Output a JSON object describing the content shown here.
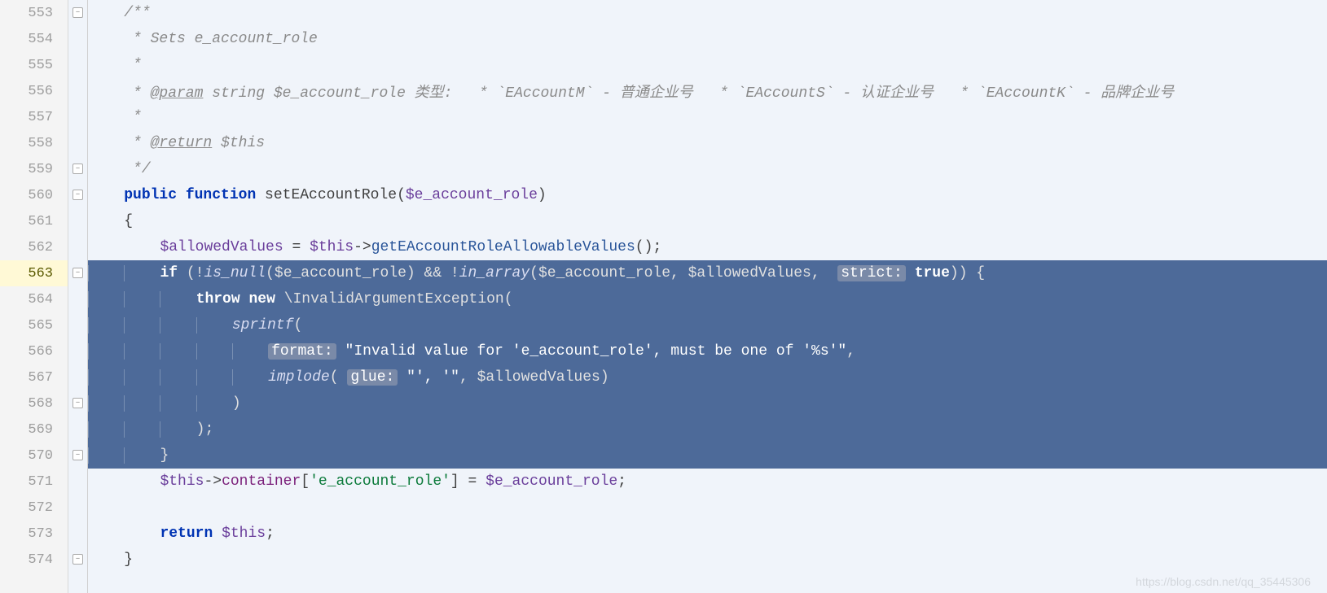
{
  "line_start": 553,
  "current_line": 563,
  "fold_markers": [
    {
      "at": 553,
      "glyph": "–"
    },
    {
      "at": 559,
      "glyph": "–"
    },
    {
      "at": 560,
      "glyph": "–"
    },
    {
      "at": 563,
      "glyph": "–"
    },
    {
      "at": 568,
      "glyph": "–"
    },
    {
      "at": 570,
      "glyph": "–"
    },
    {
      "at": 574,
      "glyph": "–"
    }
  ],
  "hints": {
    "strict": "strict:",
    "format": "format:",
    "glue": "glue:"
  },
  "code": [
    {
      "n": 553,
      "sel": false,
      "indent": 4,
      "tokens": [
        [
          "comment",
          "/**"
        ]
      ]
    },
    {
      "n": 554,
      "sel": false,
      "indent": 4,
      "tokens": [
        [
          "comment",
          " * Sets e_account_role"
        ]
      ]
    },
    {
      "n": 555,
      "sel": false,
      "indent": 4,
      "tokens": [
        [
          "comment",
          " *"
        ]
      ]
    },
    {
      "n": 556,
      "sel": false,
      "indent": 4,
      "tokens": [
        [
          "comment",
          " * "
        ],
        [
          "doctag",
          "@param"
        ],
        [
          "comment",
          " string $e_account_role 类型:   * `EAccountM` - 普通企业号   * `EAccountS` - 认证企业号   * `EAccountK` - 品牌企业号"
        ]
      ]
    },
    {
      "n": 557,
      "sel": false,
      "indent": 4,
      "tokens": [
        [
          "comment",
          " *"
        ]
      ]
    },
    {
      "n": 558,
      "sel": false,
      "indent": 4,
      "tokens": [
        [
          "comment",
          " * "
        ],
        [
          "doctag",
          "@return"
        ],
        [
          "comment",
          " $this"
        ]
      ]
    },
    {
      "n": 559,
      "sel": false,
      "indent": 4,
      "tokens": [
        [
          "comment",
          " */"
        ]
      ]
    },
    {
      "n": 560,
      "sel": false,
      "indent": 4,
      "tokens": [
        [
          "keyword",
          "public function "
        ],
        [
          "plain",
          "setEAccountRole("
        ],
        [
          "var",
          "$e_account_role"
        ],
        [
          "plain",
          ")"
        ]
      ]
    },
    {
      "n": 561,
      "sel": false,
      "indent": 4,
      "tokens": [
        [
          "plain",
          "{"
        ]
      ]
    },
    {
      "n": 562,
      "sel": false,
      "indent": 8,
      "tokens": [
        [
          "var",
          "$allowedValues"
        ],
        [
          "plain",
          " = "
        ],
        [
          "var",
          "$this"
        ],
        [
          "plain",
          "->"
        ],
        [
          "func",
          "getEAccountRoleAllowableValues"
        ],
        [
          "plain",
          "();"
        ]
      ]
    },
    {
      "n": 563,
      "sel": true,
      "indent": 8,
      "caret": true,
      "tokens": [
        [
          "keyword",
          "if "
        ],
        [
          "plain",
          "(!"
        ],
        [
          "func",
          "is_null"
        ],
        [
          "plain",
          "("
        ],
        [
          "var",
          "$e_account_role"
        ],
        [
          "plain",
          ") && !"
        ],
        [
          "func",
          "in_array"
        ],
        [
          "plain",
          "("
        ],
        [
          "var",
          "$e_account_role"
        ],
        [
          "plain",
          ", "
        ],
        [
          "var",
          "$allowedValues"
        ],
        [
          "plain",
          ",  "
        ],
        [
          "hint",
          "strict"
        ],
        [
          "plain",
          " "
        ],
        [
          "keyword",
          "true"
        ],
        [
          "plain",
          ")) {"
        ]
      ]
    },
    {
      "n": 564,
      "sel": true,
      "indent": 12,
      "tokens": [
        [
          "keyword",
          "throw new "
        ],
        [
          "plain",
          "\\InvalidArgumentException("
        ]
      ]
    },
    {
      "n": 565,
      "sel": true,
      "indent": 16,
      "tokens": [
        [
          "func",
          "sprintf"
        ],
        [
          "plain",
          "("
        ]
      ]
    },
    {
      "n": 566,
      "sel": true,
      "indent": 20,
      "tokens": [
        [
          "hint",
          "format"
        ],
        [
          "plain",
          " "
        ],
        [
          "str",
          "\"Invalid value for 'e_account_role', must be one of '%s'\""
        ],
        [
          "plain",
          ","
        ]
      ]
    },
    {
      "n": 567,
      "sel": true,
      "indent": 20,
      "tokens": [
        [
          "func",
          "implode"
        ],
        [
          "plain",
          "( "
        ],
        [
          "hint",
          "glue"
        ],
        [
          "plain",
          " "
        ],
        [
          "str",
          "\"', '\""
        ],
        [
          "plain",
          ", "
        ],
        [
          "var",
          "$allowedValues"
        ],
        [
          "plain",
          ")"
        ]
      ]
    },
    {
      "n": 568,
      "sel": true,
      "indent": 16,
      "tokens": [
        [
          "plain",
          ")"
        ]
      ]
    },
    {
      "n": 569,
      "sel": true,
      "indent": 12,
      "tokens": [
        [
          "plain",
          ");"
        ]
      ]
    },
    {
      "n": 570,
      "sel": true,
      "indent": 8,
      "tokens": [
        [
          "plain",
          "}"
        ]
      ]
    },
    {
      "n": 571,
      "sel": false,
      "indent": 8,
      "tokens": [
        [
          "var",
          "$this"
        ],
        [
          "plain",
          "->"
        ],
        [
          "prop",
          "container"
        ],
        [
          "plain",
          "["
        ],
        [
          "str",
          "'e_account_role'"
        ],
        [
          "plain",
          "] = "
        ],
        [
          "var",
          "$e_account_role"
        ],
        [
          "plain",
          ";"
        ]
      ]
    },
    {
      "n": 572,
      "sel": false,
      "indent": 8,
      "tokens": []
    },
    {
      "n": 573,
      "sel": false,
      "indent": 8,
      "tokens": [
        [
          "keyword",
          "return "
        ],
        [
          "var",
          "$this"
        ],
        [
          "plain",
          ";"
        ]
      ]
    },
    {
      "n": 574,
      "sel": false,
      "indent": 4,
      "tokens": [
        [
          "plain",
          "}"
        ]
      ]
    }
  ],
  "watermark": "https://blog.csdn.net/qq_35445306"
}
